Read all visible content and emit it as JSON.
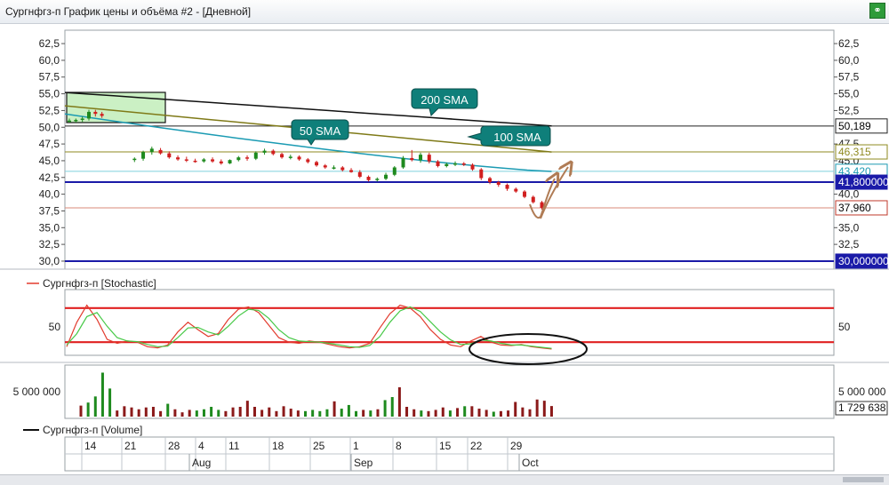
{
  "window": {
    "title": "Сургнфгз-п График цены и объёма #2 - [Дневной]",
    "link_icon": "link-icon"
  },
  "price_pane": {
    "left_ticks": [
      "62,5",
      "60,0",
      "57,5",
      "55,0",
      "52,5",
      "50,0",
      "47,5",
      "45,0",
      "42,5",
      "40,0",
      "37,5",
      "35,0",
      "32,5",
      "30,0"
    ],
    "right_ticks": [
      "62,5",
      "60,0",
      "57,5",
      "55,0",
      "52,5",
      "47,5",
      "45,0",
      "40,0",
      "35,0",
      "32,5"
    ],
    "price_labels": [
      {
        "text": "50,189",
        "value": 50.189,
        "bg": "#ffffff",
        "color": "#000000",
        "border": "#222222"
      },
      {
        "text": "46,315",
        "value": 46.315,
        "bg": "#ffffff",
        "color": "#8f8a1f",
        "border": "#8f8a1f"
      },
      {
        "text": "43,420",
        "value": 43.42,
        "bg": "#ffffff",
        "color": "#1b9bb3",
        "border": "#1b9bb3"
      },
      {
        "text": "41,800000",
        "value": 41.8,
        "bg": "#1a1aa8",
        "color": "#ffffff",
        "border": "#1a1aa8"
      },
      {
        "text": "37,960",
        "value": 37.96,
        "bg": "#ffffff",
        "color": "#000000",
        "border": "#c0392b"
      },
      {
        "text": "30,000000",
        "value": 30.0,
        "bg": "#1a1aa8",
        "color": "#ffffff",
        "border": "#1a1aa8"
      }
    ],
    "callouts": [
      {
        "text": "200 SMA",
        "name": "callout-200-sma"
      },
      {
        "text": "100 SMA",
        "name": "callout-100-sma"
      },
      {
        "text": "50 SMA",
        "name": "callout-50-sma"
      }
    ]
  },
  "stoch_pane": {
    "legend": "Сургнфгз-п [Stochastic]",
    "left_tick": "50",
    "right_tick": "50"
  },
  "volume_pane": {
    "left_tick": "5 000 000",
    "right_ticks": [
      "5 000 000",
      "1 729 638"
    ],
    "legend": "Сургнфгз-п [Volume]"
  },
  "x_axis": {
    "day_labels": [
      "14",
      "21",
      "28",
      "4",
      "11",
      "18",
      "25",
      "1",
      "8",
      "15",
      "22",
      "29"
    ],
    "month_labels": [
      "Aug",
      "Sep",
      "Oct"
    ]
  },
  "chart_data": [
    {
      "type": "candlestick",
      "title": "Сургнфгз-п График цены и объёма #2 - [Дневной]",
      "y_axis_ticks": [
        62.5,
        60.0,
        57.5,
        55.0,
        52.5,
        50.0,
        47.5,
        45.0,
        42.5,
        40.0,
        37.5,
        35.0,
        32.5,
        30.0
      ],
      "ylim": [
        28.8,
        64.5
      ],
      "sessions_count": 75,
      "candles": [
        {
          "o": 51.0,
          "h": 51.3,
          "l": 50.7,
          "c": 51.0
        },
        {
          "o": 51.0,
          "h": 51.3,
          "l": 50.7,
          "c": 51.1
        },
        {
          "o": 51.1,
          "h": 51.6,
          "l": 50.8,
          "c": 51.3
        },
        {
          "o": 51.3,
          "h": 52.6,
          "l": 51.0,
          "c": 52.3
        },
        {
          "o": 52.3,
          "h": 52.6,
          "l": 51.6,
          "c": 52.0
        },
        {
          "o": 52.0,
          "h": 52.3,
          "l": 51.4,
          "c": 51.7
        },
        {
          "o": 45.2,
          "h": 45.5,
          "l": 44.8,
          "c": 45.3
        },
        {
          "o": 45.3,
          "h": 46.5,
          "l": 45.0,
          "c": 46.3
        },
        {
          "o": 46.3,
          "h": 47.1,
          "l": 45.9,
          "c": 46.8
        },
        {
          "o": 46.6,
          "h": 46.9,
          "l": 45.9,
          "c": 46.1
        },
        {
          "o": 46.1,
          "h": 46.4,
          "l": 45.3,
          "c": 45.5
        },
        {
          "o": 45.5,
          "h": 45.8,
          "l": 45.0,
          "c": 45.2
        },
        {
          "o": 45.2,
          "h": 45.6,
          "l": 44.8,
          "c": 45.0
        },
        {
          "o": 45.0,
          "h": 45.3,
          "l": 44.7,
          "c": 44.9
        },
        {
          "o": 44.9,
          "h": 45.4,
          "l": 44.7,
          "c": 45.2
        },
        {
          "o": 45.2,
          "h": 45.5,
          "l": 44.7,
          "c": 44.9
        },
        {
          "o": 44.9,
          "h": 45.2,
          "l": 44.4,
          "c": 44.6
        },
        {
          "o": 44.6,
          "h": 45.2,
          "l": 44.5,
          "c": 45.1
        },
        {
          "o": 45.1,
          "h": 45.7,
          "l": 44.9,
          "c": 45.5
        },
        {
          "o": 45.5,
          "h": 45.8,
          "l": 45.0,
          "c": 45.3
        },
        {
          "o": 45.3,
          "h": 46.4,
          "l": 45.1,
          "c": 46.2
        },
        {
          "o": 46.2,
          "h": 46.8,
          "l": 45.9,
          "c": 46.5
        },
        {
          "o": 46.5,
          "h": 46.7,
          "l": 45.8,
          "c": 46.0
        },
        {
          "o": 46.0,
          "h": 46.2,
          "l": 45.3,
          "c": 45.5
        },
        {
          "o": 45.5,
          "h": 45.9,
          "l": 45.2,
          "c": 45.6
        },
        {
          "o": 45.6,
          "h": 45.8,
          "l": 45.0,
          "c": 45.2
        },
        {
          "o": 45.2,
          "h": 45.4,
          "l": 44.6,
          "c": 44.8
        },
        {
          "o": 44.8,
          "h": 45.0,
          "l": 44.1,
          "c": 44.3
        },
        {
          "o": 44.3,
          "h": 44.5,
          "l": 43.8,
          "c": 44.0
        },
        {
          "o": 44.0,
          "h": 44.3,
          "l": 43.7,
          "c": 44.0
        },
        {
          "o": 44.0,
          "h": 44.2,
          "l": 43.4,
          "c": 43.6
        },
        {
          "o": 43.6,
          "h": 43.9,
          "l": 43.2,
          "c": 43.3
        },
        {
          "o": 43.3,
          "h": 43.6,
          "l": 42.4,
          "c": 42.6
        },
        {
          "o": 42.6,
          "h": 42.8,
          "l": 41.9,
          "c": 42.1
        },
        {
          "o": 42.1,
          "h": 42.5,
          "l": 41.9,
          "c": 42.3
        },
        {
          "o": 42.3,
          "h": 43.2,
          "l": 42.1,
          "c": 42.9
        },
        {
          "o": 42.9,
          "h": 44.2,
          "l": 42.7,
          "c": 44.0
        },
        {
          "o": 44.0,
          "h": 45.7,
          "l": 43.8,
          "c": 45.4
        },
        {
          "o": 45.4,
          "h": 46.6,
          "l": 44.9,
          "c": 45.1
        },
        {
          "o": 45.1,
          "h": 46.2,
          "l": 44.7,
          "c": 45.9
        },
        {
          "o": 45.9,
          "h": 46.2,
          "l": 44.6,
          "c": 44.9
        },
        {
          "o": 44.9,
          "h": 45.1,
          "l": 44.0,
          "c": 44.2
        },
        {
          "o": 44.2,
          "h": 44.7,
          "l": 44.0,
          "c": 44.5
        },
        {
          "o": 44.5,
          "h": 44.9,
          "l": 44.2,
          "c": 44.6
        },
        {
          "o": 44.6,
          "h": 44.8,
          "l": 44.2,
          "c": 44.4
        },
        {
          "o": 44.4,
          "h": 44.6,
          "l": 43.5,
          "c": 43.7
        },
        {
          "o": 43.7,
          "h": 43.9,
          "l": 42.1,
          "c": 42.4
        },
        {
          "o": 42.4,
          "h": 42.6,
          "l": 41.5,
          "c": 41.8
        },
        {
          "o": 41.8,
          "h": 42.0,
          "l": 41.1,
          "c": 41.4
        },
        {
          "o": 41.4,
          "h": 41.6,
          "l": 40.5,
          "c": 40.8
        },
        {
          "o": 40.8,
          "h": 41.0,
          "l": 40.2,
          "c": 40.4
        },
        {
          "o": 40.4,
          "h": 40.6,
          "l": 39.4,
          "c": 39.6
        },
        {
          "o": 39.6,
          "h": 39.8,
          "l": 38.6,
          "c": 38.8
        },
        {
          "o": 38.8,
          "h": 39.0,
          "l": 37.7,
          "c": 37.96
        }
      ],
      "sma": [
        {
          "label": "200 SMA",
          "color": "#111111",
          "from": 55.2,
          "to": 50.2
        },
        {
          "label": "100 SMA",
          "color": "#7f7a18",
          "from": 53.2,
          "to": 46.3
        },
        {
          "label": "50 SMA",
          "color": "#1b9bb3",
          "from": 52.0,
          "to": 43.4
        }
      ],
      "horizontal_lines": [
        {
          "value": 50.189,
          "color": "#222222"
        },
        {
          "value": 46.315,
          "color": "#8f8a1f"
        },
        {
          "value": 43.42,
          "color": "#7fd0de"
        },
        {
          "value": 41.8,
          "color": "#1a1aa8"
        },
        {
          "value": 37.96,
          "color": "#d98878"
        },
        {
          "value": 30.0,
          "color": "#1a1aa8"
        }
      ]
    },
    {
      "type": "line",
      "title": "Сургнфгз-п [Stochastic]",
      "ylim": [
        0,
        100
      ],
      "levels": [
        80,
        20
      ],
      "series": [
        {
          "name": "Сургнфгз-п [Stochastic]",
          "color": "#e23b2e",
          "values": [
            12,
            55,
            85,
            60,
            25,
            18,
            22,
            20,
            12,
            10,
            15,
            38,
            55,
            42,
            30,
            35,
            60,
            78,
            82,
            72,
            50,
            28,
            20,
            18,
            22,
            20,
            16,
            12,
            10,
            12,
            18,
            45,
            70,
            85,
            80,
            65,
            42,
            25,
            15,
            12,
            22,
            30,
            20,
            15,
            14,
            16,
            12,
            10,
            8
          ]
        },
        {
          "name": "",
          "color": "#47c947",
          "values": [
            15,
            35,
            65,
            72,
            48,
            28,
            22,
            21,
            16,
            12,
            13,
            28,
            45,
            46,
            38,
            33,
            48,
            66,
            78,
            76,
            62,
            42,
            28,
            22,
            21,
            20,
            18,
            15,
            12,
            11,
            14,
            30,
            55,
            75,
            82,
            74,
            56,
            38,
            24,
            16,
            17,
            24,
            22,
            18,
            15,
            15,
            13,
            11,
            9
          ]
        }
      ]
    },
    {
      "type": "bar",
      "title": "Сургнфгз-п [Volume]",
      "ylim": [
        0,
        8000000
      ],
      "values": [
        1800000,
        2300000,
        3300000,
        7200000,
        4600000,
        1000000,
        1700000,
        1500000,
        1200000,
        1500000,
        1600000,
        900000,
        2100000,
        1200000,
        700000,
        1100000,
        1000000,
        1200000,
        1600000,
        1100000,
        900000,
        1500000,
        1600000,
        2600000,
        1600000,
        1100000,
        1500000,
        900000,
        1700000,
        1300000,
        1000000,
        900000,
        1100000,
        900000,
        1200000,
        2500000,
        1300000,
        1900000,
        900000,
        1100000,
        1000000,
        1200000,
        2700000,
        3200000,
        4800000,
        1600000,
        1200000,
        1000000,
        900000,
        1100000,
        1500000,
        1000000,
        1400000,
        1700000,
        1700000,
        1300000,
        1100000,
        800000,
        900000,
        1000000,
        2400000,
        1500000,
        1200000,
        2800000,
        2600000,
        1729638
      ],
      "colors": [
        "#8b1a1a",
        "#1e8a1e",
        "#1e8a1e",
        "#1e8a1e",
        "#1e8a1e",
        "#8b1a1a",
        "#8b1a1a",
        "#8b1a1a",
        "#8b1a1a",
        "#8b1a1a",
        "#8b1a1a",
        "#8b1a1a",
        "#1e8a1e",
        "#8b1a1a",
        "#8b1a1a",
        "#8b1a1a",
        "#1e8a1e",
        "#1e8a1e",
        "#1e8a1e",
        "#1e8a1e",
        "#8b1a1a",
        "#8b1a1a",
        "#8b1a1a",
        "#8b1a1a",
        "#8b1a1a",
        "#8b1a1a",
        "#8b1a1a",
        "#8b1a1a",
        "#8b1a1a",
        "#8b1a1a",
        "#8b1a1a",
        "#1e8a1e",
        "#1e8a1e",
        "#1e8a1e",
        "#1e8a1e",
        "#8b1a1a",
        "#1e8a1e",
        "#1e8a1e",
        "#1e8a1e",
        "#8b1a1a",
        "#1e8a1e",
        "#8b1a1a",
        "#1e8a1e",
        "#1e8a1e",
        "#8b1a1a",
        "#8b1a1a",
        "#8b1a1a",
        "#1e8a1e",
        "#8b1a1a",
        "#8b1a1a",
        "#8b1a1a",
        "#1e8a1e",
        "#8b1a1a",
        "#1e8a1e",
        "#8b1a1a",
        "#8b1a1a",
        "#8b1a1a",
        "#1e8a1e",
        "#8b1a1a",
        "#8b1a1a",
        "#8b1a1a",
        "#8b1a1a",
        "#8b1a1a",
        "#8b1a1a",
        "#8b1a1a",
        "#8b1a1a"
      ]
    }
  ]
}
